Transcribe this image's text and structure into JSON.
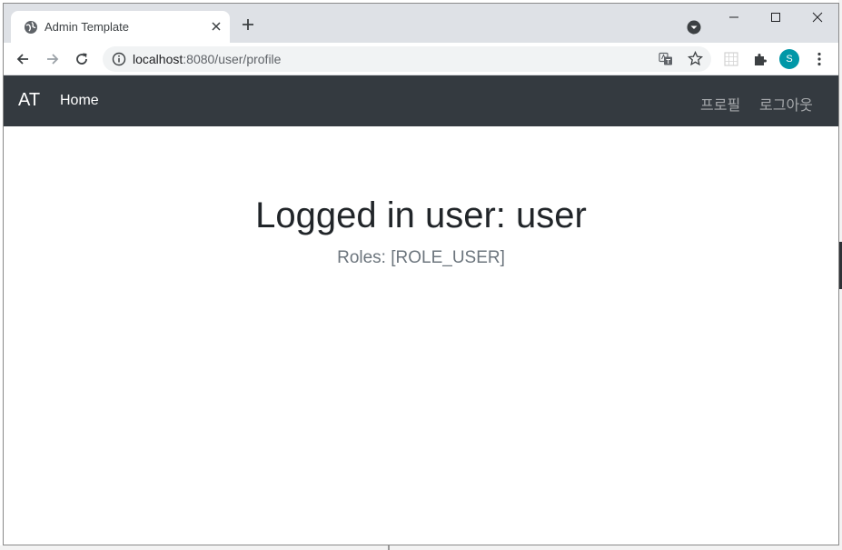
{
  "browser": {
    "tab": {
      "title": "Admin Template",
      "favicon": "globe-icon"
    },
    "address_bar": {
      "host": "localhost",
      "rest": ":8080/user/profile"
    },
    "profile_initial": "S",
    "colors": {
      "tabstrip": "#dee1e6",
      "avatar": "#0097a7"
    }
  },
  "navbar": {
    "brand": "AT",
    "home_label": "Home",
    "profile_label": "프로필",
    "logout_label": "로그아웃",
    "colors": {
      "background": "#343a40"
    }
  },
  "main": {
    "heading": "Logged in user: user",
    "roles_text": "Roles: [ROLE_USER]"
  }
}
